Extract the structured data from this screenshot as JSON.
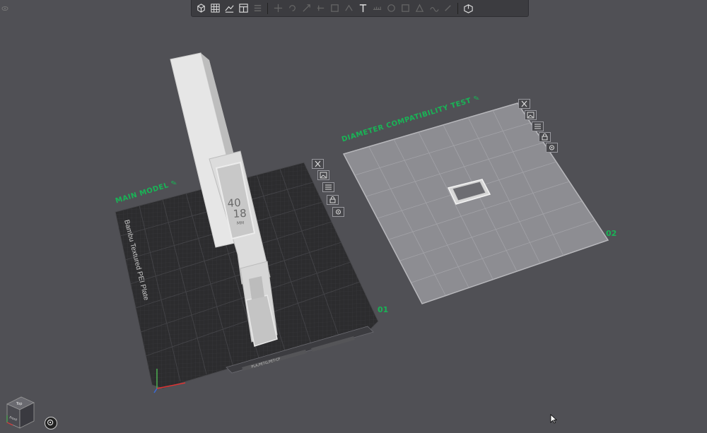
{
  "plates": [
    {
      "label": "MAIN MODEL",
      "number": "01",
      "plate_type": "Bambu Textured PEI Plate",
      "filament": "PLA,PETG,PET-CF"
    },
    {
      "label": "DIAMETER COMPATIBILITY TEST",
      "number": "02"
    }
  ],
  "model": {
    "label_top": "40",
    "label_mid": "18",
    "label_unit": "MM"
  },
  "navcube": {
    "top": "Top",
    "front": "Front"
  },
  "icons": {
    "toolbar": [
      "add-cube-icon",
      "grid-icon",
      "arrange-icon",
      "plate-icon",
      "layers-icon",
      "move-icon",
      "rotate-icon",
      "scale-icon",
      "cut-icon",
      "support-icon",
      "seam-icon",
      "text-icon",
      "measure-icon",
      "assembly-icon",
      "split-icon",
      "emboss-icon",
      "fuzzy-icon",
      "paint-icon",
      "view-icon"
    ],
    "plate_buttons": [
      "close-icon",
      "image-icon",
      "settings-icon",
      "lock-icon",
      "gear-icon"
    ]
  },
  "colors": {
    "accent": "#19b456",
    "background": "#505055",
    "bed_dark": "#2c2c2e",
    "bed_light": "#8d8d92"
  }
}
